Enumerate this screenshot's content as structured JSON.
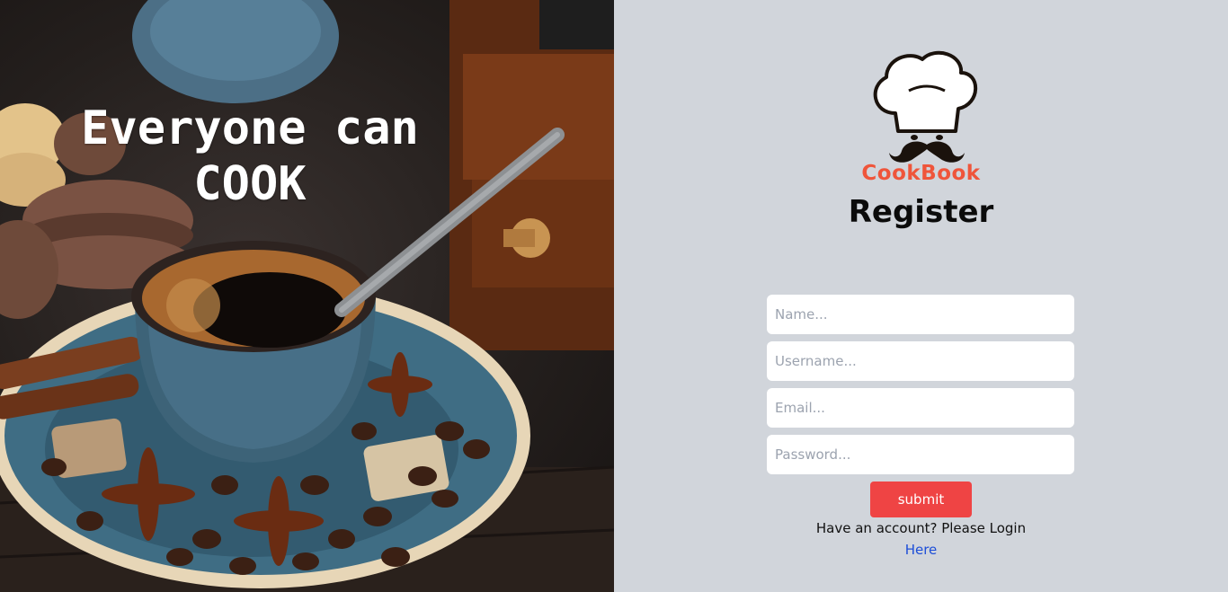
{
  "hero": {
    "title": "Everyone can\nCOOK"
  },
  "brand": {
    "name": "CookBook",
    "icon": "chef-hat-mustache-icon",
    "color": "#ef553b"
  },
  "form": {
    "heading": "Register",
    "fields": {
      "name": {
        "placeholder": "Name...",
        "value": ""
      },
      "username": {
        "placeholder": "Username...",
        "value": ""
      },
      "email": {
        "placeholder": "Email...",
        "value": ""
      },
      "password": {
        "placeholder": "Password...",
        "value": ""
      }
    },
    "submit_label": "submit",
    "submit_color": "#ef4444",
    "account_prompt": "Have an account? Please Login",
    "login_link": "Here",
    "link_color": "#1d4ed8"
  },
  "colors": {
    "panel_background": "#d1d5db"
  }
}
